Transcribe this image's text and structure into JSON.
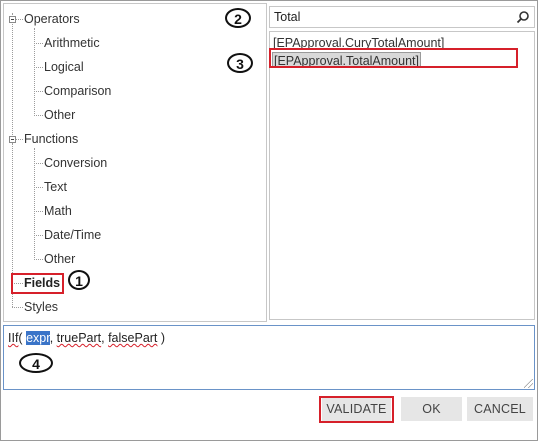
{
  "tree": {
    "operators": {
      "label": "Operators",
      "children": [
        "Arithmetic",
        "Logical",
        "Comparison",
        "Other"
      ]
    },
    "functions": {
      "label": "Functions",
      "children": [
        "Conversion",
        "Text",
        "Math",
        "Date/Time",
        "Other"
      ]
    },
    "fields": "Fields",
    "styles": "Styles"
  },
  "search": {
    "value": "Total",
    "icon": "search-icon"
  },
  "fields_list": [
    {
      "label": "[EPApproval.CuryTotalAmount]",
      "selected": false
    },
    {
      "label": "[EPApproval.TotalAmount]",
      "selected": true
    }
  ],
  "expression": {
    "fn": "IIf",
    "open": "( ",
    "arg1": "expr",
    "sep1": ", ",
    "arg2": "truePart",
    "sep2": ", ",
    "arg3": "falsePart",
    "close": " )"
  },
  "buttons": {
    "validate": "VALIDATE",
    "ok": "OK",
    "cancel": "CANCEL"
  },
  "callouts": {
    "one": "1",
    "two": "2",
    "three": "3",
    "four": "4"
  },
  "colors": {
    "highlight_box": "#d6202a",
    "selection_bg": "#d9d9d9",
    "button_bg": "#e6e6e6",
    "text_highlight": "#3a74c8"
  }
}
